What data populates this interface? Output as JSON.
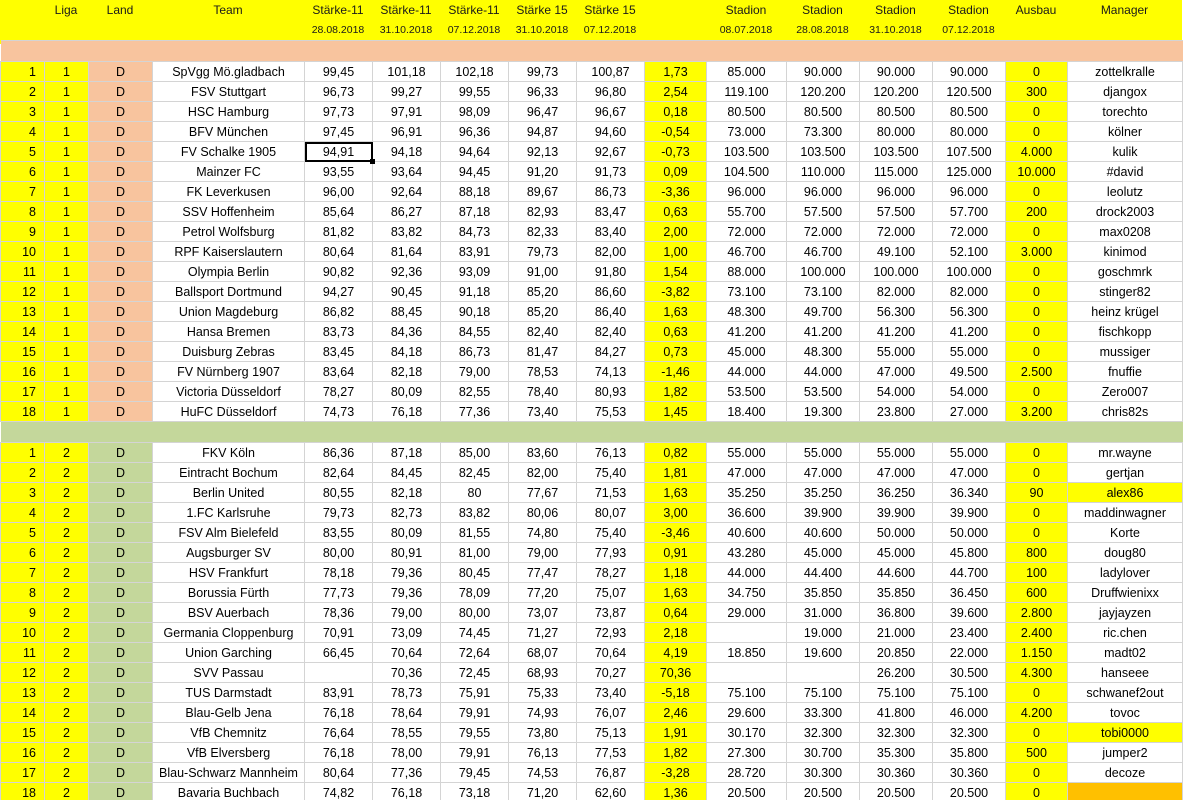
{
  "header": {
    "rank": "",
    "liga": "Liga",
    "land": "Land",
    "team": "Team",
    "s11_a": "Stärke-11",
    "s11_b": "Stärke-11",
    "s11_c": "Stärke-11",
    "s15_a": "Stärke 15",
    "s15_b": "Stärke 15",
    "diff": "",
    "st_a": "Stadion",
    "st_b": "Stadion",
    "st_c": "Stadion",
    "st_d": "Stadion",
    "ausbau": "Ausbau",
    "manager": "Manager",
    "d_rank": "",
    "d_liga": "",
    "d_land": "",
    "d_team": "",
    "d_s11_a": "28.08.2018",
    "d_s11_b": "31.10.2018",
    "d_s11_c": "07.12.2018",
    "d_s15_a": "31.10.2018",
    "d_s15_b": "07.12.2018",
    "d_diff": "",
    "d_st_a": "08.07.2018",
    "d_st_b": "28.08.2018",
    "d_st_c": "31.10.2018",
    "d_st_d": "07.12.2018",
    "d_ausbau": "",
    "d_manager": ""
  },
  "liga1": [
    {
      "rank": "1",
      "liga": "1",
      "land": "D",
      "team": "SpVgg Mö.gladbach",
      "s11a": "99,45",
      "s11b": "101,18",
      "s11c": "102,18",
      "s15a": "99,73",
      "s15b": "100,87",
      "diff": "1,73",
      "sta": "85.000",
      "stb": "90.000",
      "stc": "90.000",
      "std": "90.000",
      "ausbau": "0",
      "manager": "zottelkralle"
    },
    {
      "rank": "2",
      "liga": "1",
      "land": "D",
      "team": "FSV Stuttgart",
      "s11a": "96,73",
      "s11b": "99,27",
      "s11c": "99,55",
      "s15a": "96,33",
      "s15b": "96,80",
      "diff": "2,54",
      "sta": "119.100",
      "stb": "120.200",
      "stc": "120.200",
      "std": "120.500",
      "ausbau": "300",
      "manager": "djangox"
    },
    {
      "rank": "3",
      "liga": "1",
      "land": "D",
      "team": "HSC Hamburg",
      "s11a": "97,73",
      "s11b": "97,91",
      "s11c": "98,09",
      "s15a": "96,47",
      "s15b": "96,67",
      "diff": "0,18",
      "sta": "80.500",
      "stb": "80.500",
      "stc": "80.500",
      "std": "80.500",
      "ausbau": "0",
      "manager": "torechto"
    },
    {
      "rank": "4",
      "liga": "1",
      "land": "D",
      "team": "BFV München",
      "s11a": "97,45",
      "s11b": "96,91",
      "s11c": "96,36",
      "s15a": "94,87",
      "s15b": "94,60",
      "diff": "-0,54",
      "sta": "73.000",
      "stb": "73.300",
      "stc": "80.000",
      "std": "80.000",
      "ausbau": "0",
      "manager": "kölner"
    },
    {
      "rank": "5",
      "liga": "1",
      "land": "D",
      "team": "FV Schalke 1905",
      "s11a": "94,91",
      "s11b": "94,18",
      "s11c": "94,64",
      "s15a": "92,13",
      "s15b": "92,67",
      "diff": "-0,73",
      "sta": "103.500",
      "stb": "103.500",
      "stc": "103.500",
      "std": "107.500",
      "ausbau": "4.000",
      "manager": "kulik"
    },
    {
      "rank": "6",
      "liga": "1",
      "land": "D",
      "team": "Mainzer FC",
      "s11a": "93,55",
      "s11b": "93,64",
      "s11c": "94,45",
      "s15a": "91,20",
      "s15b": "91,73",
      "diff": "0,09",
      "sta": "104.500",
      "stb": "110.000",
      "stc": "115.000",
      "std": "125.000",
      "ausbau": "10.000",
      "manager": "#david"
    },
    {
      "rank": "7",
      "liga": "1",
      "land": "D",
      "team": "FK Leverkusen",
      "s11a": "96,00",
      "s11b": "92,64",
      "s11c": "88,18",
      "s15a": "89,67",
      "s15b": "86,73",
      "diff": "-3,36",
      "sta": "96.000",
      "stb": "96.000",
      "stc": "96.000",
      "std": "96.000",
      "ausbau": "0",
      "manager": "leolutz"
    },
    {
      "rank": "8",
      "liga": "1",
      "land": "D",
      "team": "SSV Hoffenheim",
      "s11a": "85,64",
      "s11b": "86,27",
      "s11c": "87,18",
      "s15a": "82,93",
      "s15b": "83,47",
      "diff": "0,63",
      "sta": "55.700",
      "stb": "57.500",
      "stc": "57.500",
      "std": "57.700",
      "ausbau": "200",
      "manager": "drock2003"
    },
    {
      "rank": "9",
      "liga": "1",
      "land": "D",
      "team": "Petrol Wolfsburg",
      "s11a": "81,82",
      "s11b": "83,82",
      "s11c": "84,73",
      "s15a": "82,33",
      "s15b": "83,40",
      "diff": "2,00",
      "sta": "72.000",
      "stb": "72.000",
      "stc": "72.000",
      "std": "72.000",
      "ausbau": "0",
      "manager": "max0208"
    },
    {
      "rank": "10",
      "liga": "1",
      "land": "D",
      "team": "RPF Kaiserslautern",
      "s11a": "80,64",
      "s11b": "81,64",
      "s11c": "83,91",
      "s15a": "79,73",
      "s15b": "82,00",
      "diff": "1,00",
      "sta": "46.700",
      "stb": "46.700",
      "stc": "49.100",
      "std": "52.100",
      "ausbau": "3.000",
      "manager": "kinimod"
    },
    {
      "rank": "11",
      "liga": "1",
      "land": "D",
      "team": "Olympia Berlin",
      "s11a": "90,82",
      "s11b": "92,36",
      "s11c": "93,09",
      "s15a": "91,00",
      "s15b": "91,80",
      "diff": "1,54",
      "sta": "88.000",
      "stb": "100.000",
      "stc": "100.000",
      "std": "100.000",
      "ausbau": "0",
      "manager": "goschmrk"
    },
    {
      "rank": "12",
      "liga": "1",
      "land": "D",
      "team": "Ballsport Dortmund",
      "s11a": "94,27",
      "s11b": "90,45",
      "s11c": "91,18",
      "s15a": "85,20",
      "s15b": "86,60",
      "diff": "-3,82",
      "sta": "73.100",
      "stb": "73.100",
      "stc": "82.000",
      "std": "82.000",
      "ausbau": "0",
      "manager": "stinger82"
    },
    {
      "rank": "13",
      "liga": "1",
      "land": "D",
      "team": "Union Magdeburg",
      "s11a": "86,82",
      "s11b": "88,45",
      "s11c": "90,18",
      "s15a": "85,20",
      "s15b": "86,40",
      "diff": "1,63",
      "sta": "48.300",
      "stb": "49.700",
      "stc": "56.300",
      "std": "56.300",
      "ausbau": "0",
      "manager": "heinz krügel"
    },
    {
      "rank": "14",
      "liga": "1",
      "land": "D",
      "team": "Hansa Bremen",
      "s11a": "83,73",
      "s11b": "84,36",
      "s11c": "84,55",
      "s15a": "82,40",
      "s15b": "82,40",
      "diff": "0,63",
      "sta": "41.200",
      "stb": "41.200",
      "stc": "41.200",
      "std": "41.200",
      "ausbau": "0",
      "manager": "fischkopp"
    },
    {
      "rank": "15",
      "liga": "1",
      "land": "D",
      "team": "Duisburg Zebras",
      "s11a": "83,45",
      "s11b": "84,18",
      "s11c": "86,73",
      "s15a": "81,47",
      "s15b": "84,27",
      "diff": "0,73",
      "sta": "45.000",
      "stb": "48.300",
      "stc": "55.000",
      "std": "55.000",
      "ausbau": "0",
      "manager": "mussiger"
    },
    {
      "rank": "16",
      "liga": "1",
      "land": "D",
      "team": "FV Nürnberg 1907",
      "s11a": "83,64",
      "s11b": "82,18",
      "s11c": "79,00",
      "s15a": "78,53",
      "s15b": "74,13",
      "diff": "-1,46",
      "sta": "44.000",
      "stb": "44.000",
      "stc": "47.000",
      "std": "49.500",
      "ausbau": "2.500",
      "manager": "fnuffie"
    },
    {
      "rank": "17",
      "liga": "1",
      "land": "D",
      "team": "Victoria Düsseldorf",
      "s11a": "78,27",
      "s11b": "80,09",
      "s11c": "82,55",
      "s15a": "78,40",
      "s15b": "80,93",
      "diff": "1,82",
      "sta": "53.500",
      "stb": "53.500",
      "stc": "54.000",
      "std": "54.000",
      "ausbau": "0",
      "manager": "Zero007"
    },
    {
      "rank": "18",
      "liga": "1",
      "land": "D",
      "team": "HuFC Düsseldorf",
      "s11a": "74,73",
      "s11b": "76,18",
      "s11c": "77,36",
      "s15a": "73,40",
      "s15b": "75,53",
      "diff": "1,45",
      "sta": "18.400",
      "stb": "19.300",
      "stc": "23.800",
      "std": "27.000",
      "ausbau": "3.200",
      "manager": "chris82s"
    }
  ],
  "liga2": [
    {
      "rank": "1",
      "liga": "2",
      "land": "D",
      "team": "FKV Köln",
      "s11a": "86,36",
      "s11b": "87,18",
      "s11c": "85,00",
      "s15a": "83,60",
      "s15b": "76,13",
      "diff": "0,82",
      "sta": "55.000",
      "stb": "55.000",
      "stc": "55.000",
      "std": "55.000",
      "ausbau": "0",
      "manager": "mr.wayne"
    },
    {
      "rank": "2",
      "liga": "2",
      "land": "D",
      "team": "Eintracht Bochum",
      "s11a": "82,64",
      "s11b": "84,45",
      "s11c": "82,45",
      "s15a": "82,00",
      "s15b": "75,40",
      "diff": "1,81",
      "sta": "47.000",
      "stb": "47.000",
      "stc": "47.000",
      "std": "47.000",
      "ausbau": "0",
      "manager": "gertjan"
    },
    {
      "rank": "3",
      "liga": "2",
      "land": "D",
      "team": "Berlin United",
      "s11a": "80,55",
      "s11b": "82,18",
      "s11c": "80",
      "s15a": "77,67",
      "s15b": "71,53",
      "diff": "1,63",
      "sta": "35.250",
      "stb": "35.250",
      "stc": "36.250",
      "std": "36.340",
      "ausbau": "90",
      "manager": "alex86"
    },
    {
      "rank": "4",
      "liga": "2",
      "land": "D",
      "team": "1.FC Karlsruhe",
      "s11a": "79,73",
      "s11b": "82,73",
      "s11c": "83,82",
      "s15a": "80,06",
      "s15b": "80,07",
      "diff": "3,00",
      "sta": "36.600",
      "stb": "39.900",
      "stc": "39.900",
      "std": "39.900",
      "ausbau": "0",
      "manager": "maddinwagner"
    },
    {
      "rank": "5",
      "liga": "2",
      "land": "D",
      "team": "FSV Alm Bielefeld",
      "s11a": "83,55",
      "s11b": "80,09",
      "s11c": "81,55",
      "s15a": "74,80",
      "s15b": "75,40",
      "diff": "-3,46",
      "sta": "40.600",
      "stb": "40.600",
      "stc": "50.000",
      "std": "50.000",
      "ausbau": "0",
      "manager": "Korte"
    },
    {
      "rank": "6",
      "liga": "2",
      "land": "D",
      "team": "Augsburger SV",
      "s11a": "80,00",
      "s11b": "80,91",
      "s11c": "81,00",
      "s15a": "79,00",
      "s15b": "77,93",
      "diff": "0,91",
      "sta": "43.280",
      "stb": "45.000",
      "stc": "45.000",
      "std": "45.800",
      "ausbau": "800",
      "manager": "doug80"
    },
    {
      "rank": "7",
      "liga": "2",
      "land": "D",
      "team": "HSV Frankfurt",
      "s11a": "78,18",
      "s11b": "79,36",
      "s11c": "80,45",
      "s15a": "77,47",
      "s15b": "78,27",
      "diff": "1,18",
      "sta": "44.000",
      "stb": "44.400",
      "stc": "44.600",
      "std": "44.700",
      "ausbau": "100",
      "manager": "ladylover"
    },
    {
      "rank": "8",
      "liga": "2",
      "land": "D",
      "team": "Borussia Fürth",
      "s11a": "77,73",
      "s11b": "79,36",
      "s11c": "78,09",
      "s15a": "77,20",
      "s15b": "75,07",
      "diff": "1,63",
      "sta": "34.750",
      "stb": "35.850",
      "stc": "35.850",
      "std": "36.450",
      "ausbau": "600",
      "manager": "Druffwienixx"
    },
    {
      "rank": "9",
      "liga": "2",
      "land": "D",
      "team": "BSV Auerbach",
      "s11a": "78,36",
      "s11b": "79,00",
      "s11c": "80,00",
      "s15a": "73,07",
      "s15b": "73,87",
      "diff": "0,64",
      "sta": "29.000",
      "stb": "31.000",
      "stc": "36.800",
      "std": "39.600",
      "ausbau": "2.800",
      "manager": "jayjayzen"
    },
    {
      "rank": "10",
      "liga": "2",
      "land": "D",
      "team": "Germania Cloppenburg",
      "s11a": "70,91",
      "s11b": "73,09",
      "s11c": "74,45",
      "s15a": "71,27",
      "s15b": "72,93",
      "diff": "2,18",
      "sta": "",
      "stb": "19.000",
      "stc": "21.000",
      "std": "23.400",
      "ausbau": "2.400",
      "manager": "ric.chen"
    },
    {
      "rank": "11",
      "liga": "2",
      "land": "D",
      "team": "Union Garching",
      "s11a": "66,45",
      "s11b": "70,64",
      "s11c": "72,64",
      "s15a": "68,07",
      "s15b": "70,64",
      "diff": "4,19",
      "sta": "18.850",
      "stb": "19.600",
      "stc": "20.850",
      "std": "22.000",
      "ausbau": "1.150",
      "manager": "madt02"
    },
    {
      "rank": "12",
      "liga": "2",
      "land": "D",
      "team": "SVV Passau",
      "s11a": "",
      "s11b": "70,36",
      "s11c": "72,45",
      "s15a": "68,93",
      "s15b": "70,27",
      "diff": "70,36",
      "sta": "",
      "stb": "",
      "stc": "26.200",
      "std": "30.500",
      "ausbau": "4.300",
      "manager": "hanseee"
    },
    {
      "rank": "13",
      "liga": "2",
      "land": "D",
      "team": "TUS Darmstadt",
      "s11a": "83,91",
      "s11b": "78,73",
      "s11c": "75,91",
      "s15a": "75,33",
      "s15b": "73,40",
      "diff": "-5,18",
      "sta": "75.100",
      "stb": "75.100",
      "stc": "75.100",
      "std": "75.100",
      "ausbau": "0",
      "manager": "schwanef2out"
    },
    {
      "rank": "14",
      "liga": "2",
      "land": "D",
      "team": "Blau-Gelb Jena",
      "s11a": "76,18",
      "s11b": "78,64",
      "s11c": "79,91",
      "s15a": "74,93",
      "s15b": "76,07",
      "diff": "2,46",
      "sta": "29.600",
      "stb": "33.300",
      "stc": "41.800",
      "std": "46.000",
      "ausbau": "4.200",
      "manager": "tovoc"
    },
    {
      "rank": "15",
      "liga": "2",
      "land": "D",
      "team": "VfB Chemnitz",
      "s11a": "76,64",
      "s11b": "78,55",
      "s11c": "79,55",
      "s15a": "73,80",
      "s15b": "75,13",
      "diff": "1,91",
      "sta": "30.170",
      "stb": "32.300",
      "stc": "32.300",
      "std": "32.300",
      "ausbau": "0",
      "manager": "tobi0000"
    },
    {
      "rank": "16",
      "liga": "2",
      "land": "D",
      "team": "VfB Elversberg",
      "s11a": "76,18",
      "s11b": "78,00",
      "s11c": "79,91",
      "s15a": "76,13",
      "s15b": "77,53",
      "diff": "1,82",
      "sta": "27.300",
      "stb": "30.700",
      "stc": "35.300",
      "std": "35.800",
      "ausbau": "500",
      "manager": "jumper2"
    },
    {
      "rank": "17",
      "liga": "2",
      "land": "D",
      "team": "Blau-Schwarz Mannheim",
      "s11a": "80,64",
      "s11b": "77,36",
      "s11c": "79,45",
      "s15a": "74,53",
      "s15b": "76,87",
      "diff": "-3,28",
      "sta": "28.720",
      "stb": "30.300",
      "stc": "30.360",
      "std": "30.360",
      "ausbau": "0",
      "manager": "decoze"
    },
    {
      "rank": "18",
      "liga": "2",
      "land": "D",
      "team": "Bavaria Buchbach",
      "s11a": "74,82",
      "s11b": "76,18",
      "s11c": "73,18",
      "s15a": "71,20",
      "s15b": "62,60",
      "diff": "1,36",
      "sta": "20.500",
      "stb": "20.500",
      "stc": "20.500",
      "std": "20.500",
      "ausbau": "0",
      "manager": ""
    }
  ],
  "highlights": {
    "managers_yellow": [
      "alex86",
      "tobi0000"
    ],
    "manager_orange_row": "18",
    "selected_cell": "94,91"
  },
  "colors": {
    "header_yellow": "#ffff00",
    "liga1_land": "#f8c49e",
    "liga2_land": "#c4d79b",
    "manager_orange": "#ffc000"
  }
}
